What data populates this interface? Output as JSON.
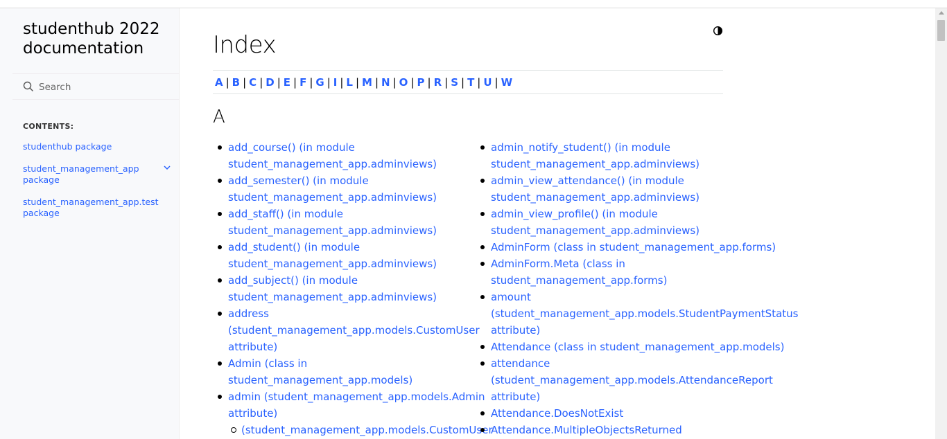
{
  "sidebar": {
    "brand": "studenthub 2022 documentation",
    "search_placeholder": "Search",
    "contents_caption": "CONTENTS:",
    "toc": [
      "studenthub package",
      "student_management_app package",
      "student_management_app.test package"
    ]
  },
  "main": {
    "title": "Index",
    "letters": [
      "A",
      "B",
      "C",
      "D",
      "E",
      "F",
      "G",
      "I",
      "L",
      "M",
      "N",
      "O",
      "P",
      "R",
      "S",
      "T",
      "U",
      "W"
    ],
    "section": "A",
    "left_entries": [
      "add_course() (in module student_management_app.adminviews)",
      "add_semester() (in module student_management_app.adminviews)",
      "add_staff() (in module student_management_app.adminviews)",
      "add_student() (in module student_management_app.adminviews)",
      "add_subject() (in module student_management_app.adminviews)",
      "address (student_management_app.models.CustomUser attribute)",
      "Admin (class in student_management_app.models)",
      "admin (student_management_app.models.Admin attribute)"
    ],
    "left_sub_entry": "(student_management_app.models.CustomUser",
    "right_entries": [
      "admin_notify_student() (in module student_management_app.adminviews)",
      "admin_view_attendance() (in module student_management_app.adminviews)",
      "admin_view_profile() (in module student_management_app.adminviews)",
      "AdminForm (class in student_management_app.forms)",
      "AdminForm.Meta (class in student_management_app.forms)",
      "amount (student_management_app.models.StudentPaymentStatus attribute)",
      "Attendance (class in student_management_app.models)",
      "attendance (student_management_app.models.AttendanceReport attribute)",
      "Attendance.DoesNotExist",
      "Attendance.MultipleObjectsReturned"
    ]
  },
  "colors": {
    "link": "#2962ff",
    "sidebar_bg": "#f8f9fb"
  }
}
